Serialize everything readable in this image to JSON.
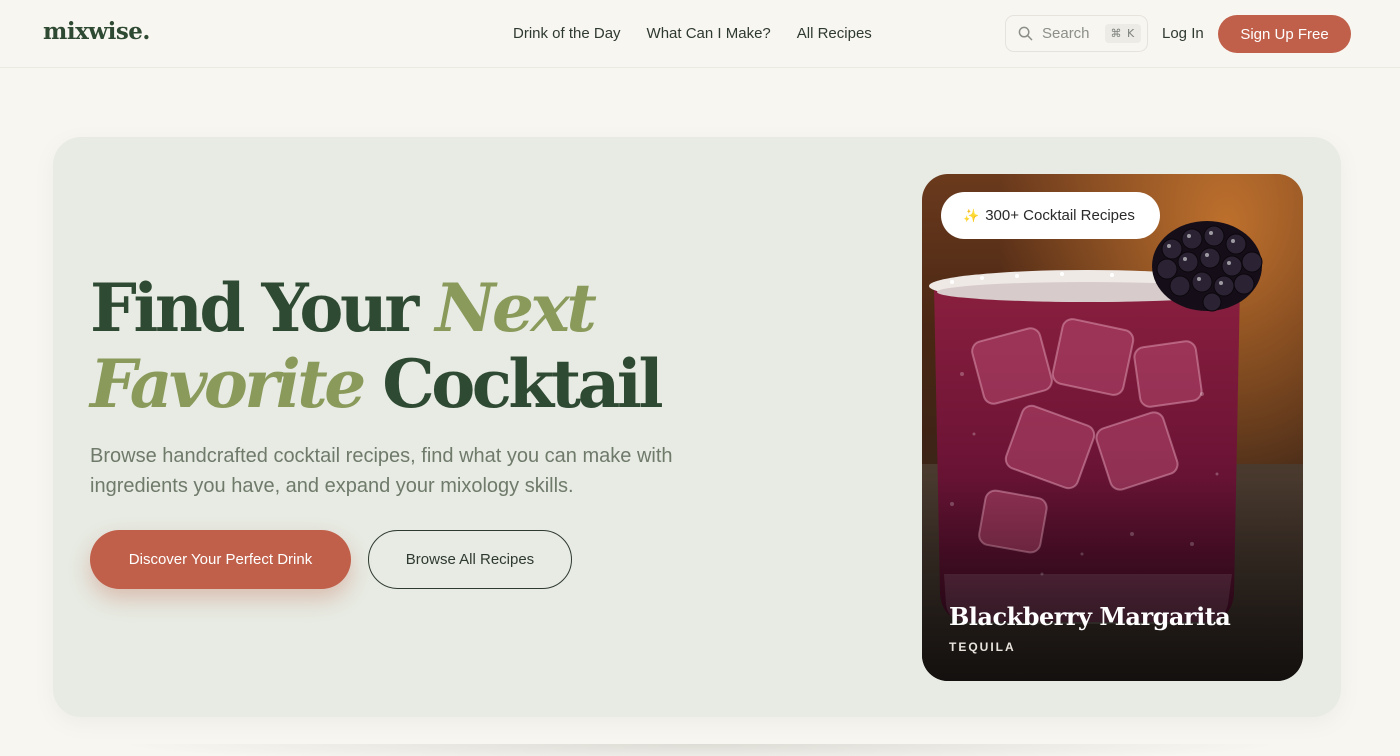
{
  "brand": {
    "logo": "mixwise."
  },
  "nav": {
    "links": [
      "Drink of the Day",
      "What Can I Make?",
      "All Recipes"
    ],
    "search_placeholder": "Search",
    "search_shortcut": "⌘ K",
    "login": "Log In",
    "signup": "Sign Up Free"
  },
  "hero": {
    "headline_part1": "Find Your ",
    "headline_accent1": "Next",
    "headline_accent2": "Favorite",
    "headline_part2": " Cocktail",
    "subtitle": "Browse handcrafted cocktail recipes, find what you can make with ingredients you have, and expand your mixology skills.",
    "primary_cta": "Discover Your Perfect Drink",
    "secondary_cta": "Browse All Recipes"
  },
  "feature_card": {
    "badge_icon": "sparkle-icon",
    "badge_text": "300+ Cocktail Recipes",
    "title": "Blackberry Margarita",
    "category": "TEQUILA"
  },
  "colors": {
    "background": "#f8f6f1",
    "hero_bg": "#e7ebe3",
    "brand_green": "#2f4a33",
    "accent_olive": "#8a9a5b",
    "cta_terracotta": "#c0604a"
  }
}
